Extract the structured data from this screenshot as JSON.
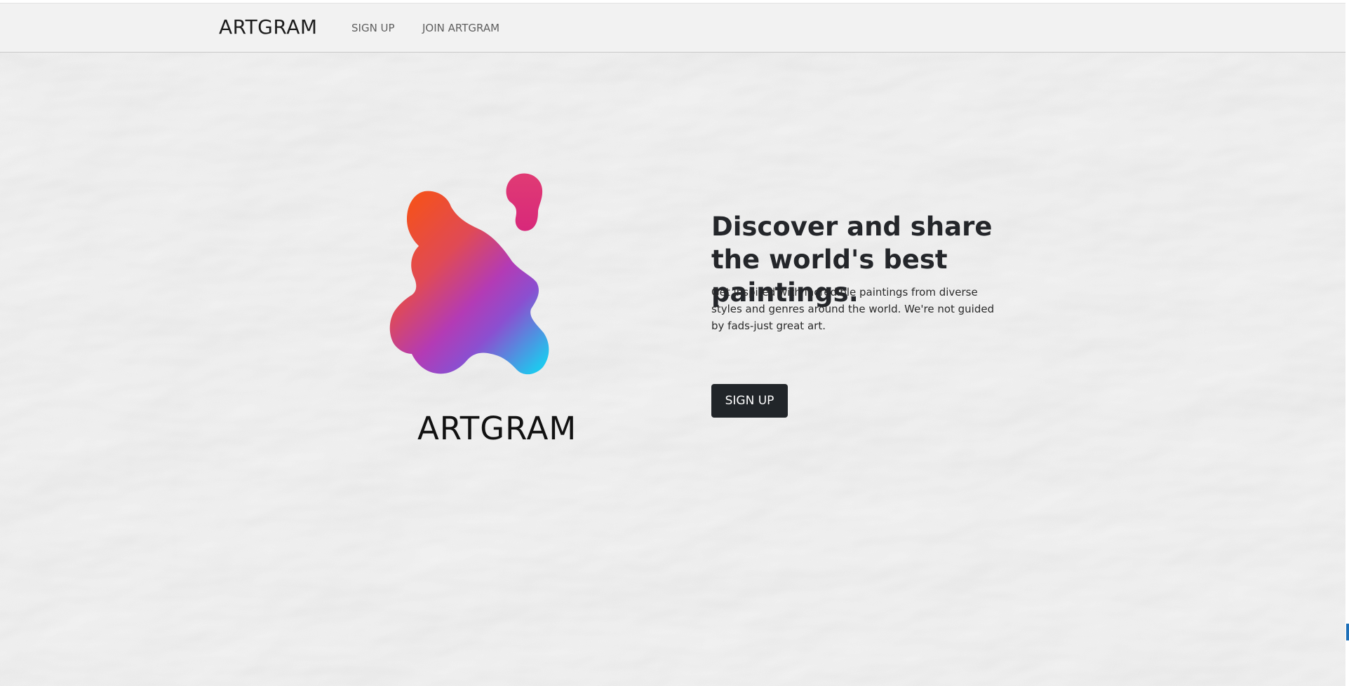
{
  "navbar": {
    "brand": "ARTGRAM",
    "links": [
      "SIGN UP",
      "JOIN ARTGRAM"
    ]
  },
  "hero": {
    "logo_word": "ARTGRAM",
    "headline": "Discover and share the world's best paintings.",
    "subtext": "Get inspired with incredible paintings from diverse styles and genres around the world. We're not guided by fads-just great art.",
    "cta_label": "SIGN UP"
  },
  "colors": {
    "nav_bg": "#f2f2f2",
    "button_bg": "#212529",
    "logo_gradient": [
      "#f4511e",
      "#e0357a",
      "#8e2de2",
      "#22c4ee"
    ]
  }
}
